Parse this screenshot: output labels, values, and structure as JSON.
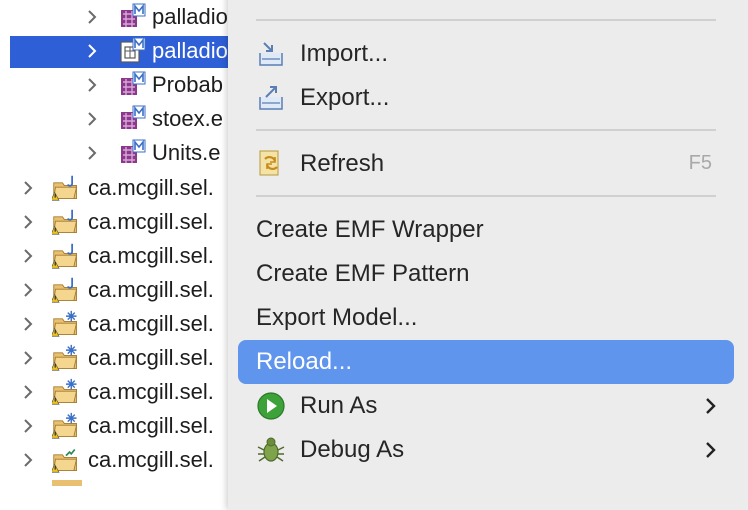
{
  "tree": {
    "children": [
      {
        "label": "palladio",
        "icon": "model-file-icon"
      },
      {
        "label": "palladio",
        "icon": "model-file-icon",
        "selected": true
      },
      {
        "label": "Probab",
        "icon": "model-file-icon"
      },
      {
        "label": "stoex.e",
        "icon": "model-file-icon"
      },
      {
        "label": "Units.e",
        "icon": "model-file-icon"
      }
    ],
    "projects": [
      {
        "label": "ca.mcgill.sel.",
        "icon": "java-project-icon"
      },
      {
        "label": "ca.mcgill.sel.",
        "icon": "java-project-icon"
      },
      {
        "label": "ca.mcgill.sel.",
        "icon": "java-project-icon"
      },
      {
        "label": "ca.mcgill.sel.",
        "icon": "java-project-icon"
      },
      {
        "label": "ca.mcgill.sel.",
        "icon": "ecore-project-icon"
      },
      {
        "label": "ca.mcgill.sel.",
        "icon": "ecore-project-icon"
      },
      {
        "label": "ca.mcgill.sel.",
        "icon": "ecore-project-icon"
      },
      {
        "label": "ca.mcgill.sel.",
        "icon": "ecore-project-icon"
      },
      {
        "label": "ca.mcgill.sel.",
        "icon": "plugin-project-icon"
      }
    ]
  },
  "menu": {
    "import": {
      "label": "Import...",
      "icon": "import-icon"
    },
    "export": {
      "label": "Export...",
      "icon": "export-icon"
    },
    "refresh": {
      "label": "Refresh",
      "icon": "refresh-icon",
      "shortcut": "F5"
    },
    "create_emf_wrapper": {
      "label": "Create EMF Wrapper"
    },
    "create_emf_pattern": {
      "label": "Create EMF Pattern"
    },
    "export_model": {
      "label": "Export Model..."
    },
    "reload": {
      "label": "Reload...",
      "highlighted": true
    },
    "run_as": {
      "label": "Run As",
      "icon": "run-icon",
      "submenu": true
    },
    "debug_as": {
      "label": "Debug As",
      "icon": "debug-bug-icon",
      "submenu": true
    }
  },
  "colors": {
    "selection": "#2f5fd6",
    "menu_highlight": "#5f95ec",
    "menu_background": "#ececec"
  }
}
